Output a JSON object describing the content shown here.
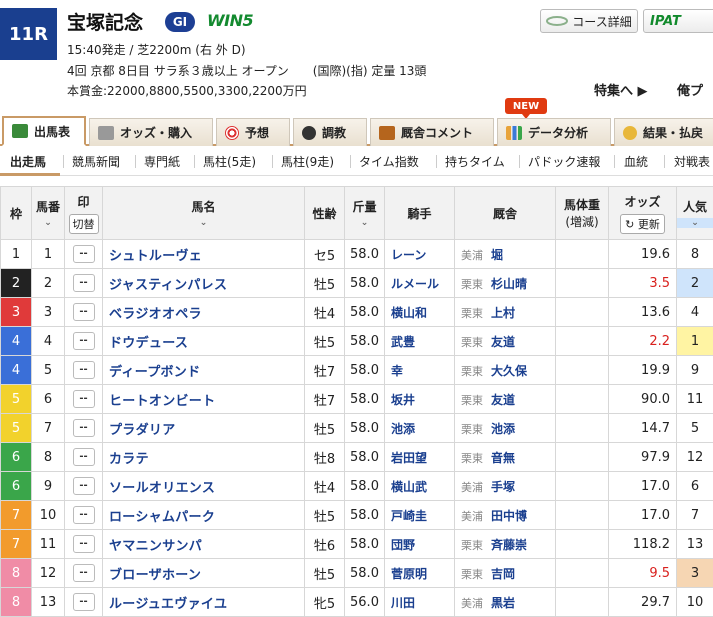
{
  "race": {
    "number": "11R",
    "title": "宝塚記念",
    "grade": "GI",
    "win5": "WIN5",
    "line1": "15:40発走 / 芝2200m (右 外 D)",
    "line2": "4回 京都 8日目 サラ系３歳以上 オープン　　(国際)(指) 定量 13頭",
    "line3": "本賞金:22000,8800,5500,3300,2200万円"
  },
  "header_buttons": {
    "course": "コース詳細",
    "ipat": "IPAT",
    "tokushu": "特集へ ▶",
    "ore": "俺プ"
  },
  "main_tabs": [
    "出馬表",
    "オッズ・購入",
    "予想",
    "調教",
    "厩舎コメント",
    "データ分析",
    "結果・払戻"
  ],
  "new_badge": "NEW",
  "sub_tabs": [
    "出走馬",
    "競馬新聞",
    "専門紙",
    "馬柱(5走)",
    "馬柱(9走)",
    "タイム指数",
    "持ちタイム",
    "パドック速報",
    "血統",
    "対戦表"
  ],
  "table_headers": {
    "waku": "枠",
    "umaban": "馬番",
    "mark": "印",
    "kirikae": "切替",
    "name": "馬名",
    "sexage": "性齢",
    "weight": "斤量",
    "jockey": "騎手",
    "stable": "厩舎",
    "bodyweight": "馬体重",
    "bodyweight2": "(増減)",
    "odds": "オッズ",
    "update": "更新",
    "popularity": "人気"
  },
  "mark_placeholder": "--",
  "horses": [
    {
      "waku": "1",
      "num": "1",
      "name": "シュトルーヴェ",
      "sexage": "セ5",
      "weight": "58.0",
      "jockey": "レーン",
      "region": "美浦",
      "trainer": "堀",
      "odds": "19.6",
      "pop": "8"
    },
    {
      "waku": "2",
      "num": "2",
      "name": "ジャスティンパレス",
      "sexage": "牡5",
      "weight": "58.0",
      "jockey": "ルメール",
      "region": "栗東",
      "trainer": "杉山晴",
      "odds": "3.5",
      "pop": "2"
    },
    {
      "waku": "3",
      "num": "3",
      "name": "ベラジオオペラ",
      "sexage": "牡4",
      "weight": "58.0",
      "jockey": "横山和",
      "region": "栗東",
      "trainer": "上村",
      "odds": "13.6",
      "pop": "4"
    },
    {
      "waku": "4",
      "num": "4",
      "name": "ドウデュース",
      "sexage": "牡5",
      "weight": "58.0",
      "jockey": "武豊",
      "region": "栗東",
      "trainer": "友道",
      "odds": "2.2",
      "pop": "1"
    },
    {
      "waku": "4",
      "num": "5",
      "name": "ディープボンド",
      "sexage": "牡7",
      "weight": "58.0",
      "jockey": "幸",
      "region": "栗東",
      "trainer": "大久保",
      "odds": "19.9",
      "pop": "9"
    },
    {
      "waku": "5",
      "num": "6",
      "name": "ヒートオンビート",
      "sexage": "牡7",
      "weight": "58.0",
      "jockey": "坂井",
      "region": "栗東",
      "trainer": "友道",
      "odds": "90.0",
      "pop": "11"
    },
    {
      "waku": "5",
      "num": "7",
      "name": "プラダリア",
      "sexage": "牡5",
      "weight": "58.0",
      "jockey": "池添",
      "region": "栗東",
      "trainer": "池添",
      "odds": "14.7",
      "pop": "5"
    },
    {
      "waku": "6",
      "num": "8",
      "name": "カラテ",
      "sexage": "牡8",
      "weight": "58.0",
      "jockey": "岩田望",
      "region": "栗東",
      "trainer": "音無",
      "odds": "97.9",
      "pop": "12"
    },
    {
      "waku": "6",
      "num": "9",
      "name": "ソールオリエンス",
      "sexage": "牡4",
      "weight": "58.0",
      "jockey": "横山武",
      "region": "美浦",
      "trainer": "手塚",
      "odds": "17.0",
      "pop": "6"
    },
    {
      "waku": "7",
      "num": "10",
      "name": "ローシャムパーク",
      "sexage": "牡5",
      "weight": "58.0",
      "jockey": "戸崎圭",
      "region": "美浦",
      "trainer": "田中博",
      "odds": "17.0",
      "pop": "7"
    },
    {
      "waku": "7",
      "num": "11",
      "name": "ヤマニンサンパ",
      "sexage": "牡6",
      "weight": "58.0",
      "jockey": "団野",
      "region": "栗東",
      "trainer": "斉藤崇",
      "odds": "118.2",
      "pop": "13"
    },
    {
      "waku": "8",
      "num": "12",
      "name": "ブローザホーン",
      "sexage": "牡5",
      "weight": "58.0",
      "jockey": "菅原明",
      "region": "栗東",
      "trainer": "吉岡",
      "odds": "9.5",
      "pop": "3"
    },
    {
      "waku": "8",
      "num": "13",
      "name": "ルージュエヴァイユ",
      "sexage": "牝5",
      "weight": "56.0",
      "jockey": "川田",
      "region": "美浦",
      "trainer": "黒岩",
      "odds": "29.7",
      "pop": "10"
    }
  ],
  "colors": {
    "waku": {
      "1": "#ffffff",
      "2": "#222222",
      "3": "#e03a3a",
      "4": "#3a6fd8",
      "5": "#f2d22c",
      "6": "#3aa64a",
      "7": "#f29b2c",
      "8": "#f08ca6"
    },
    "brand": "#1a3f8f",
    "hot_odds": "#d9211e"
  }
}
